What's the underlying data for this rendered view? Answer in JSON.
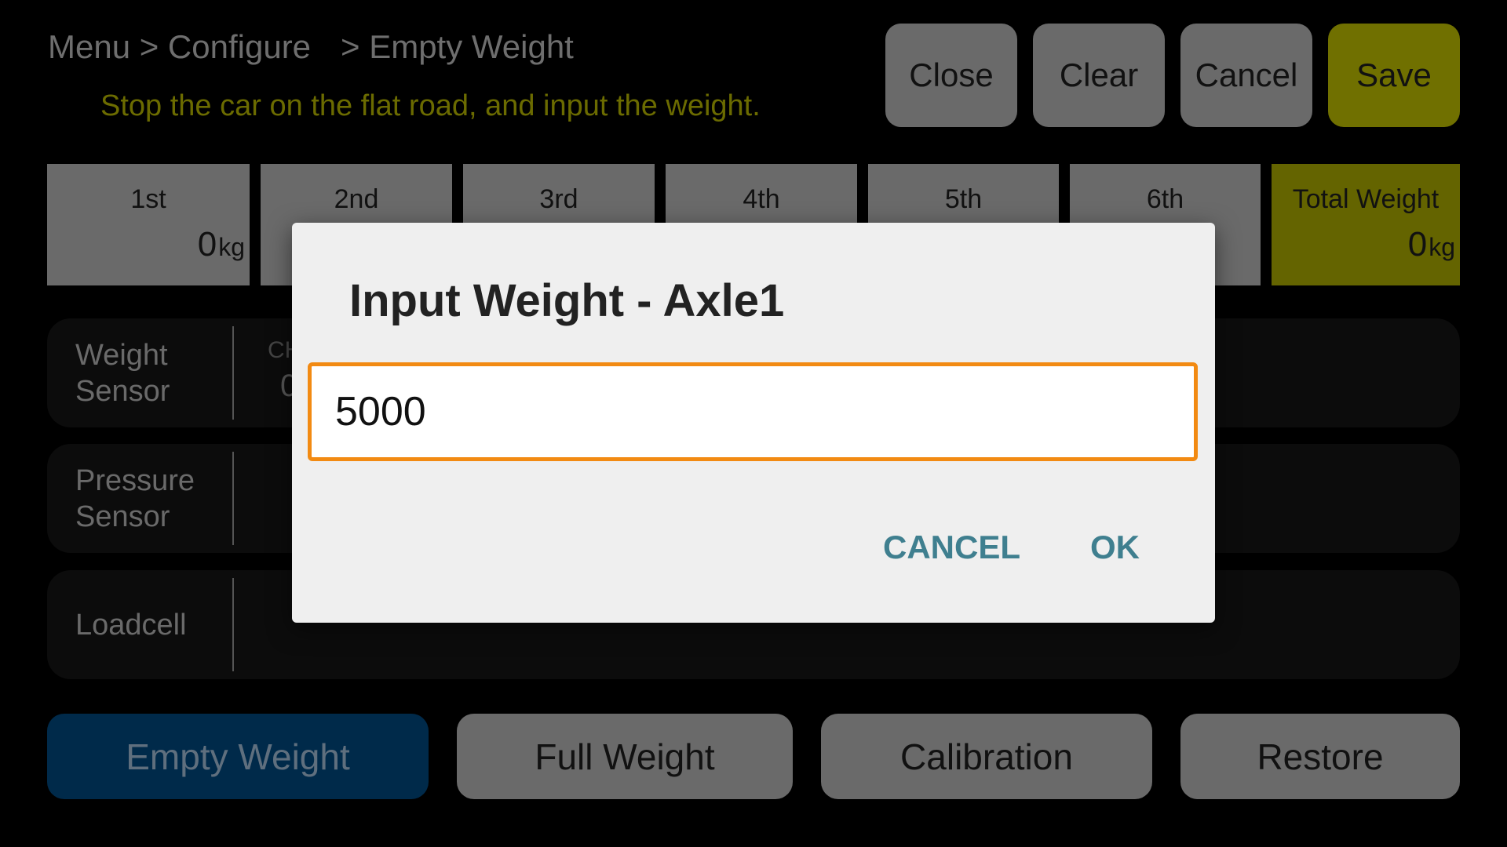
{
  "breadcrumb": {
    "part1": "Menu > Configure",
    "part2": "> Empty Weight"
  },
  "hint": "Stop the car on the flat road, and input the weight.",
  "toolbar": {
    "close": "Close",
    "clear": "Clear",
    "cancel": "Cancel",
    "save": "Save"
  },
  "axles": [
    {
      "label": "1st",
      "value": "0",
      "unit": "kg"
    },
    {
      "label": "2nd"
    },
    {
      "label": "3rd"
    },
    {
      "label": "4th"
    },
    {
      "label": "5th"
    },
    {
      "label": "6th"
    }
  ],
  "total": {
    "label": "Total Weight",
    "value": "0",
    "unit": "kg"
  },
  "sensors": [
    {
      "name": "Weight\nSensor",
      "ch": "CH",
      "value": "0"
    },
    {
      "name": "Pressure\nSensor"
    },
    {
      "name": "Loadcell"
    }
  ],
  "modes": {
    "empty": "Empty Weight",
    "full": "Full Weight",
    "calibration": "Calibration",
    "restore": "Restore"
  },
  "dialog": {
    "title": "Input Weight - Axle1",
    "value": "5000",
    "cancel": "CANCEL",
    "ok": "OK"
  },
  "colors": {
    "accent_olive": "#707000",
    "active_blue": "#002a4a",
    "input_border": "#f28a12",
    "dialog_button": "#3f7f8f"
  }
}
